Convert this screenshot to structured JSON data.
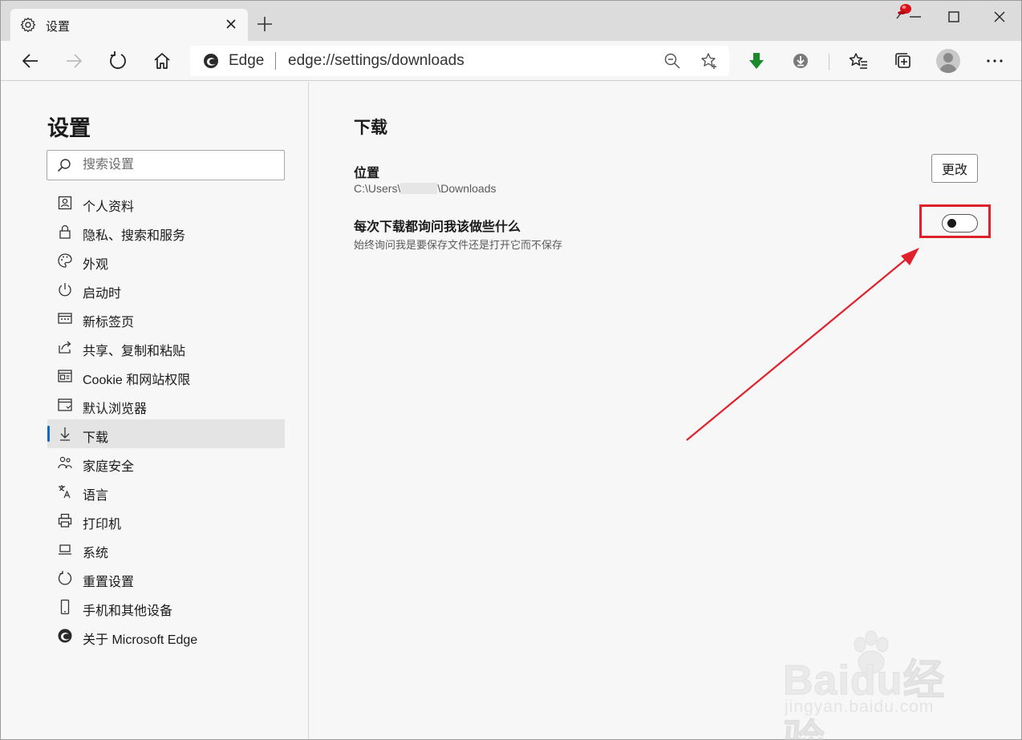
{
  "window": {
    "tab_title": "设置",
    "tab_icon": "gear-icon",
    "controls": [
      "minimize-icon",
      "maximize-icon",
      "close-icon"
    ]
  },
  "toolbar": {
    "address_brand": "Edge",
    "address_url": "edge://settings/downloads",
    "icons": [
      "back-icon",
      "forward-icon",
      "refresh-icon",
      "home-icon",
      "zoom-out-icon",
      "favorite-star-icon",
      "green-download-arrow-icon",
      "download-circle-icon",
      "favorites-icon",
      "collections-icon",
      "profile-avatar",
      "more-icon"
    ]
  },
  "sidebar": {
    "title": "设置",
    "search_placeholder": "搜索设置",
    "items": [
      {
        "label": "个人资料",
        "icon": "profile-icon"
      },
      {
        "label": "隐私、搜索和服务",
        "icon": "lock-icon"
      },
      {
        "label": "外观",
        "icon": "palette-icon"
      },
      {
        "label": "启动时",
        "icon": "power-icon"
      },
      {
        "label": "新标签页",
        "icon": "new-tab-page-icon"
      },
      {
        "label": "共享、复制和粘贴",
        "icon": "share-icon"
      },
      {
        "label": "Cookie 和网站权限",
        "icon": "site-permissions-icon"
      },
      {
        "label": "默认浏览器",
        "icon": "browser-icon"
      },
      {
        "label": "下载",
        "icon": "download-icon",
        "active": true
      },
      {
        "label": "家庭安全",
        "icon": "family-icon"
      },
      {
        "label": "语言",
        "icon": "language-icon"
      },
      {
        "label": "打印机",
        "icon": "printer-icon"
      },
      {
        "label": "系统",
        "icon": "laptop-icon"
      },
      {
        "label": "重置设置",
        "icon": "reset-icon"
      },
      {
        "label": "手机和其他设备",
        "icon": "phone-icon"
      },
      {
        "label": "关于 Microsoft Edge",
        "icon": "edge-logo-icon"
      }
    ]
  },
  "main": {
    "title": "下载",
    "location": {
      "label": "位置",
      "path_prefix": "C:\\Users\\",
      "path_suffix": "\\Downloads",
      "change_button": "更改"
    },
    "ask": {
      "label": "每次下载都询问我该做些什么",
      "description": "始终询问我是要保存文件还是打开它而不保存",
      "toggle_on": false
    }
  },
  "annotation": {
    "color": "#e0202a"
  },
  "watermark": {
    "brand": "Baidu经验",
    "site": "jingyan.baidu.com"
  }
}
